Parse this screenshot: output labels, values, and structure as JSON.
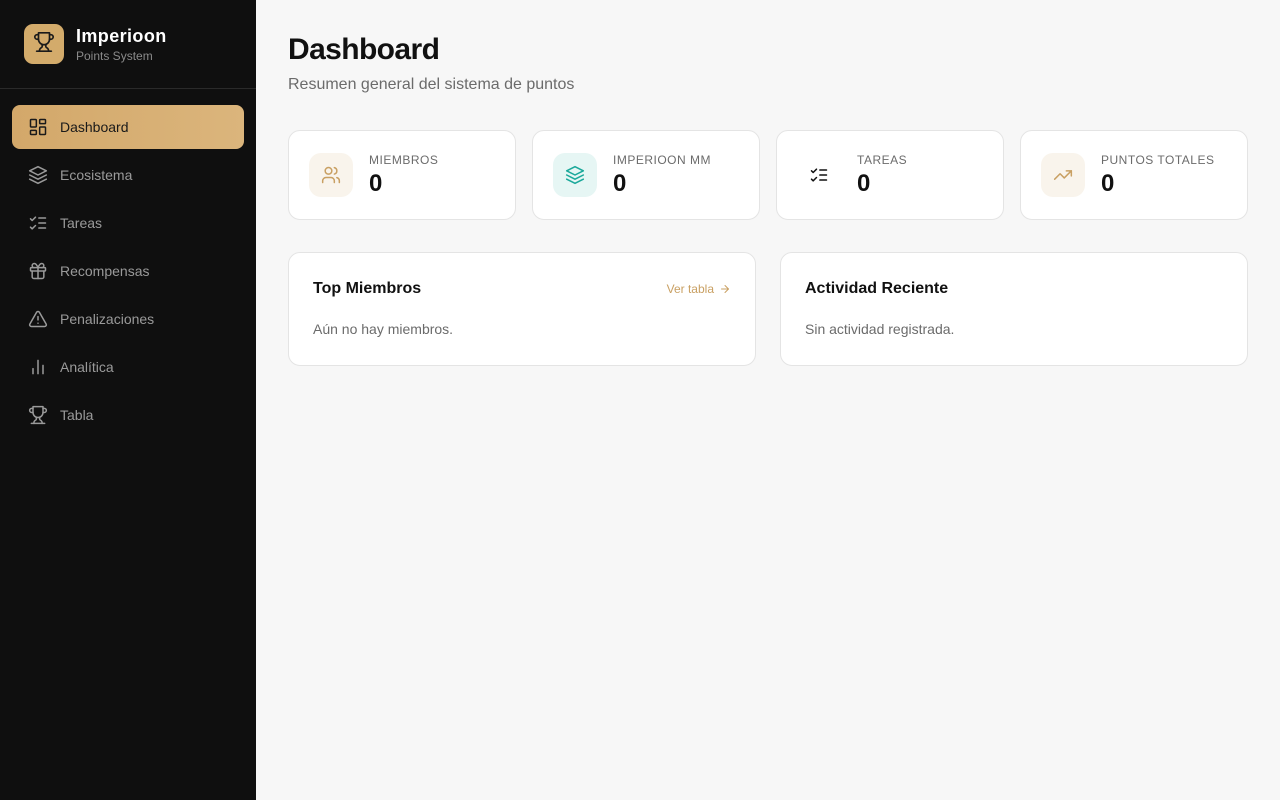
{
  "brand": {
    "name": "Imperioon",
    "subtitle": "Points System",
    "accent": "#d3ab6b",
    "icon": "trophy-icon"
  },
  "sidebar": {
    "items": [
      {
        "label": "Dashboard",
        "icon": "dashboard-icon",
        "active": true
      },
      {
        "label": "Ecosistema",
        "icon": "layers-icon",
        "active": false
      },
      {
        "label": "Tareas",
        "icon": "list-checks-icon",
        "active": false
      },
      {
        "label": "Recompensas",
        "icon": "gift-icon",
        "active": false
      },
      {
        "label": "Penalizaciones",
        "icon": "alert-triangle-icon",
        "active": false
      },
      {
        "label": "Analítica",
        "icon": "bar-chart-icon",
        "active": false
      },
      {
        "label": "Tabla",
        "icon": "trophy-icon",
        "active": false
      }
    ]
  },
  "header": {
    "title": "Dashboard",
    "subtitle": "Resumen general del sistema de puntos"
  },
  "stats": [
    {
      "label": "MIEMBROS",
      "value": "0",
      "icon": "users-icon",
      "color": "#c9a063"
    },
    {
      "label": "IMPERIOON MM",
      "value": "0",
      "icon": "layers-icon",
      "color": "#1aa89a"
    },
    {
      "label": "TAREAS",
      "value": "0",
      "icon": "list-checks-icon",
      "color": "#111111"
    },
    {
      "label": "PUNTOS TOTALES",
      "value": "0",
      "icon": "trending-up-icon",
      "color": "#c9a063"
    }
  ],
  "panels": {
    "top_members": {
      "title": "Top Miembros",
      "link_label": "Ver tabla",
      "empty_text": "Aún no hay miembros."
    },
    "recent_activity": {
      "title": "Actividad Reciente",
      "empty_text": "Sin actividad registrada."
    }
  }
}
